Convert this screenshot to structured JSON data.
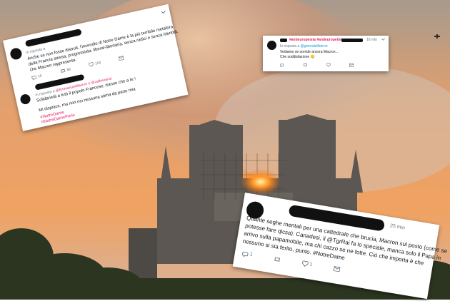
{
  "tweet1": {
    "reply_prefix": "In risposta a",
    "lines": [
      "Anche se non fosse distrutt, l'incendio di Notre Dame è la più terribile metafora",
      "della Francia stessa, progressista, liberal-libertaria, senza radici e senza identità,",
      "che Macron rappresenta."
    ],
    "counts": {
      "replies": "16",
      "retweets": "86",
      "likes": "104"
    },
    "reply_handles": "@EmmanuelMacron e @catfreeanzi",
    "reply_lines": [
      "Solidarietà a tutti il popolo Francese, tranne che a te !",
      "",
      "Mi dispiace, ma non nei nessuna stima da parte mia"
    ],
    "hashtags": [
      "#NotreDame",
      "#NotreDameParis"
    ]
  },
  "tweet2": {
    "name": "#antieuropeista #antieuropelista",
    "time": "16 min",
    "reply_prefix": "In risposta a",
    "reply_handle": "@giornaleliberno",
    "lines": [
      "Vediamo se sorride ancora Macron...",
      "Che soddisfazione"
    ],
    "emoji": "🙂"
  },
  "tweet3": {
    "time": "25 min",
    "lines": [
      "Quante seghe mentali per una cattedrale che brucia, Macron sul posto (come se",
      "potesse fare qlcsa). Canadesi, il @TgrRai fa lo speciale, manca solo il Papa in",
      "arrivo sulla papamobile, ma chi cazzo se ne fotte. Ciò che importa è che",
      "nessuno si sia ferito, punto. #NotreDame"
    ],
    "counts": {
      "replies": "1",
      "retweets": "",
      "likes": "1"
    }
  },
  "colors": {
    "sky_top": "#8a8a88",
    "sky_orange": "#e88a4a",
    "smoke": "#c9c3bd",
    "cathedral": "#5f5a55",
    "flame": "#ff8a1a",
    "trees": "#2f3a22"
  }
}
